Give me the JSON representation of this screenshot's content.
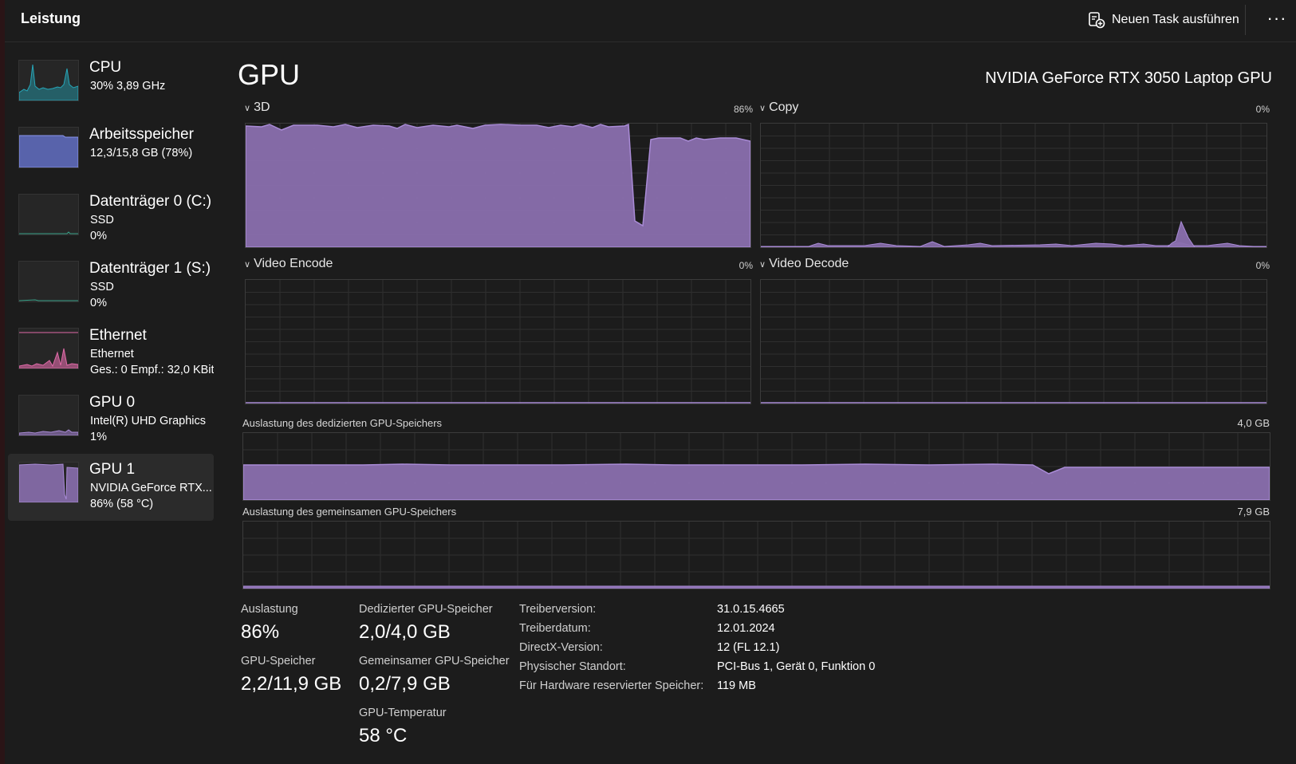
{
  "app": {
    "title": "Leistung",
    "new_task_label": "Neuen Task ausführen",
    "more_label": "···"
  },
  "sidebar": {
    "items": [
      {
        "name": "CPU",
        "line1": "30%  3,89 GHz",
        "line2": ""
      },
      {
        "name": "Arbeitsspeicher",
        "line1": "12,3/15,8 GB (78%)",
        "line2": ""
      },
      {
        "name": "Datenträger 0 (C:)",
        "line1": "SSD",
        "line2": "0%"
      },
      {
        "name": "Datenträger 1 (S:)",
        "line1": "SSD",
        "line2": "0%"
      },
      {
        "name": "Ethernet",
        "line1": "Ethernet",
        "line2": "Ges.: 0 Empf.: 32,0 KBit/s"
      },
      {
        "name": "GPU 0",
        "line1": "Intel(R) UHD Graphics",
        "line2": "1%"
      },
      {
        "name": "GPU 1",
        "line1": "NVIDIA GeForce RTX...",
        "line2": "86%  (58 °C)"
      }
    ]
  },
  "main": {
    "heading": "GPU",
    "gpu_name": "NVIDIA GeForce RTX 3050 Laptop GPU",
    "engines": [
      {
        "label": "3D",
        "percent": "86%"
      },
      {
        "label": "Copy",
        "percent": "0%"
      },
      {
        "label": "Video Encode",
        "percent": "0%"
      },
      {
        "label": "Video Decode",
        "percent": "0%"
      }
    ],
    "dedicated_memory": {
      "label": "Auslastung des dedizierten GPU-Speichers",
      "max": "4,0 GB"
    },
    "shared_memory": {
      "label": "Auslastung des gemeinsamen GPU-Speichers",
      "max": "7,9 GB"
    },
    "stats": {
      "utilization_label": "Auslastung",
      "utilization": "86%",
      "dedicated_label": "Dedizierter GPU-Speicher",
      "dedicated": "2,0/4,0 GB",
      "gpu_memory_label": "GPU-Speicher",
      "gpu_memory": "2,2/11,9 GB",
      "shared_label": "Gemeinsamer GPU-Speicher",
      "shared": "0,2/7,9 GB",
      "temp_label": "GPU-Temperatur",
      "temp": "58 °C"
    },
    "info": [
      {
        "label": "Treiberversion:",
        "value": "31.0.15.4665"
      },
      {
        "label": "Treiberdatum:",
        "value": "12.01.2024"
      },
      {
        "label": "DirectX-Version:",
        "value": "12 (FL 12.1)"
      },
      {
        "label": "Physischer Standort:",
        "value": "PCI-Bus 1, Gerät 0, Funktion 0"
      },
      {
        "label": "Für Hardware reservierter Speicher:",
        "value": "119 MB"
      }
    ]
  },
  "colors": {
    "gpu_purple": "#8a6fae",
    "gpu_line": "#a98bd6",
    "cpu_teal": "#26a6b8",
    "mem_blue": "#6a78d8",
    "eth_pink": "#e06aa8",
    "grid": "#2f2f2f"
  }
}
